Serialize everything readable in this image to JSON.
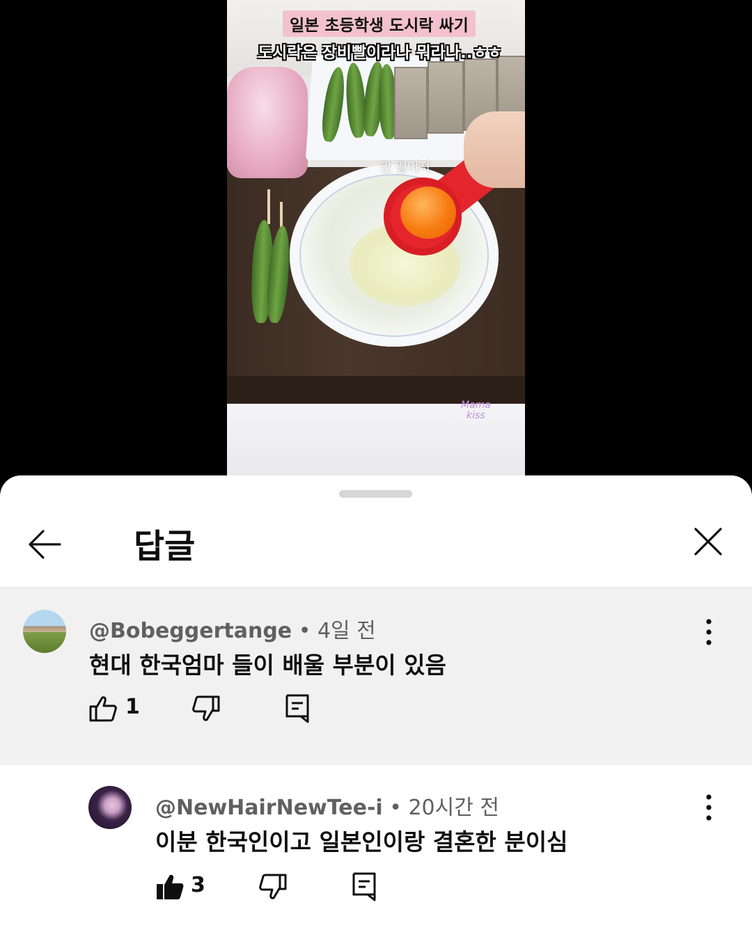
{
  "video": {
    "caption_line1": "일본 초등학생 도시락 싸기",
    "caption_line2": "도시락은 장비빨이라나 뭐라나..ㅎㅎ",
    "inner_text": "안 떨어져",
    "watermark_line1": "Mama",
    "watermark_line2": "kiss"
  },
  "sheet": {
    "title": "답글"
  },
  "comment": {
    "author": "@Bobeggertange",
    "separator": " • ",
    "time": "4일 전",
    "text": "현대 한국엄마 들이 배울 부분이 있음",
    "like_count": "1"
  },
  "reply": {
    "author": "@NewHairNewTee-i",
    "separator": " • ",
    "time": "20시간 전",
    "text": "이분 한국인이고 일본인이랑 결혼한 분이심",
    "like_count": "3"
  },
  "icons": {
    "back": "arrow-left-icon",
    "close": "close-icon",
    "more": "more-vert-icon",
    "like": "thumbs-up-icon",
    "dislike": "thumbs-down-icon",
    "reply": "reply-comment-icon"
  },
  "colors": {
    "highlight_bg": "#f1f1f1",
    "text_primary": "#0f0f0f",
    "text_secondary": "#606060"
  }
}
